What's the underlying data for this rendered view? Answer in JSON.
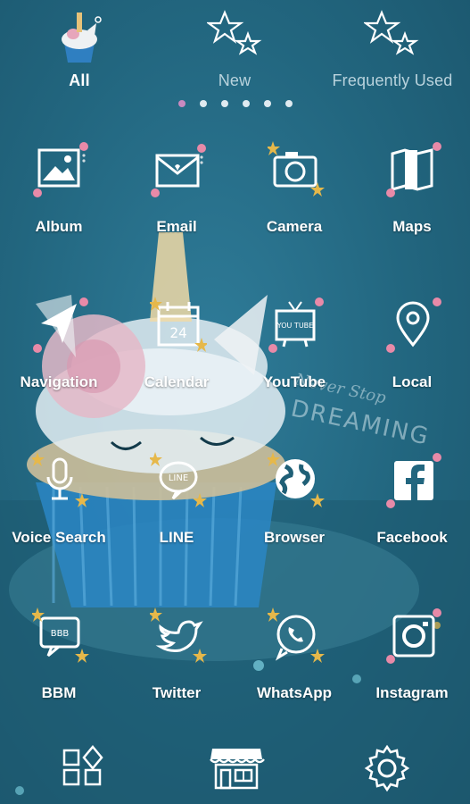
{
  "tabs": [
    {
      "label": "All",
      "icon": "cupcake-icon",
      "active": true
    },
    {
      "label": "New",
      "icon": "stars-icon",
      "active": false
    },
    {
      "label": "Frequently Used",
      "icon": "stars-icon",
      "active": false
    }
  ],
  "page_indicator": {
    "count": 6,
    "active_index": 0
  },
  "apps": [
    {
      "label": "Album",
      "icon": "photo-icon"
    },
    {
      "label": "Email",
      "icon": "envelope-icon"
    },
    {
      "label": "Camera",
      "icon": "camera-icon"
    },
    {
      "label": "Maps",
      "icon": "map-icon"
    },
    {
      "label": "Navigation",
      "icon": "navigation-arrow-icon"
    },
    {
      "label": "Calendar",
      "icon": "calendar-icon",
      "calendar_day": "24"
    },
    {
      "label": "YouTube",
      "icon": "tv-icon",
      "tv_text": "YOU TUBE"
    },
    {
      "label": "Local",
      "icon": "location-pin-icon"
    },
    {
      "label": "Voice Search",
      "icon": "microphone-icon"
    },
    {
      "label": "LINE",
      "icon": "line-bubble-icon",
      "bubble_text": "LINE"
    },
    {
      "label": "Browser",
      "icon": "globe-icon"
    },
    {
      "label": "Facebook",
      "icon": "facebook-icon"
    },
    {
      "label": "BBM",
      "icon": "bbm-icon"
    },
    {
      "label": "Twitter",
      "icon": "bird-icon"
    },
    {
      "label": "WhatsApp",
      "icon": "whatsapp-icon"
    },
    {
      "label": "Instagram",
      "icon": "instagram-icon"
    }
  ],
  "wallpaper_text": {
    "line1": "Never Stop",
    "line2": "DREAMING"
  },
  "dock": [
    {
      "icon": "widgets-icon"
    },
    {
      "icon": "store-icon"
    },
    {
      "icon": "settings-gear-icon"
    }
  ],
  "colors": {
    "background": "#22667f",
    "accent_pink": "#e88aa8",
    "star_gold": "#e6b84a"
  }
}
